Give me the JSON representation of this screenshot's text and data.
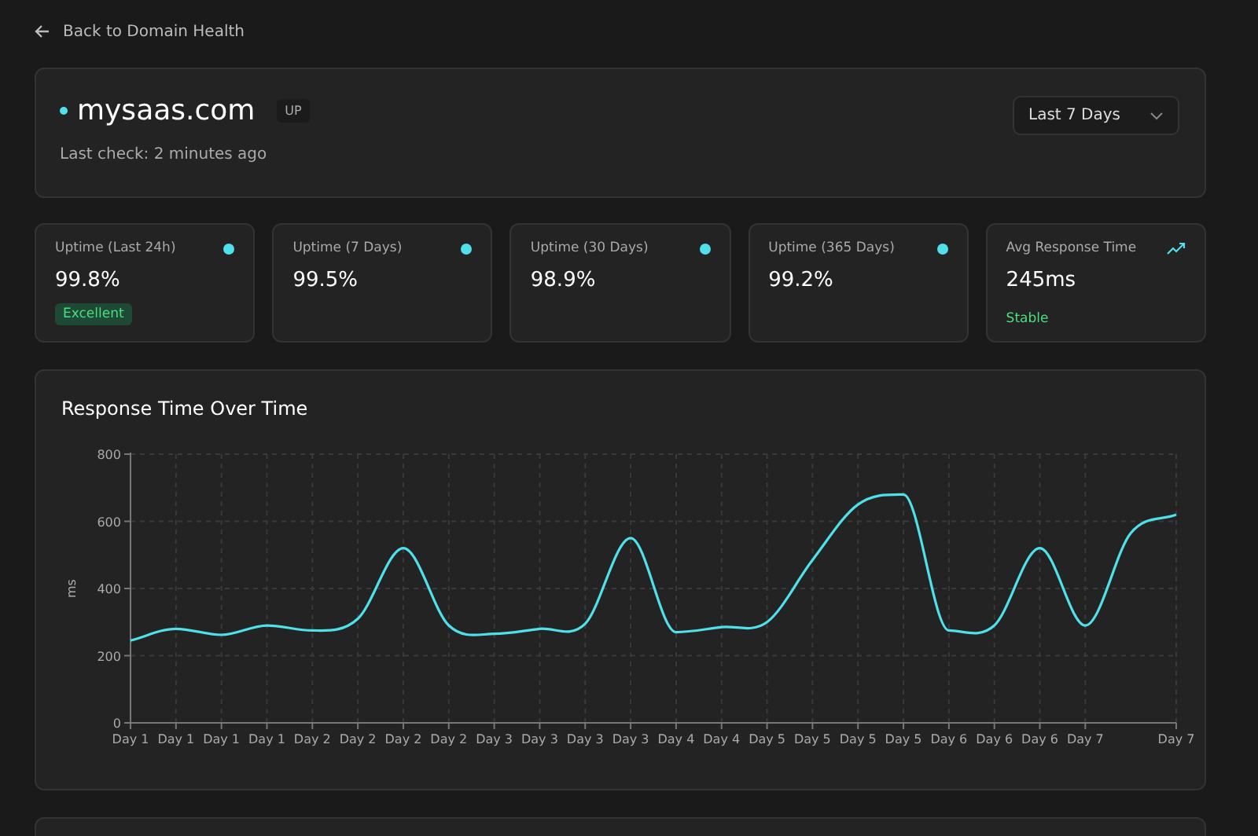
{
  "back_link": {
    "label": "Back to Domain Health"
  },
  "header": {
    "domain": "mysaas.com",
    "status_badge": "UP",
    "last_check": "Last check: 2 minutes ago",
    "period_select": {
      "value": "Last 7 Days"
    }
  },
  "stats": [
    {
      "kind": "uptime",
      "label": "Uptime (Last 24h)",
      "value": "99.8%",
      "color": "#4fe0ea",
      "badge": "Excellent"
    },
    {
      "kind": "uptime",
      "label": "Uptime (7 Days)",
      "value": "99.5%",
      "color": "#4fe0ea"
    },
    {
      "kind": "uptime",
      "label": "Uptime (30 Days)",
      "value": "98.9%",
      "color": "#4fe0ea"
    },
    {
      "kind": "uptime",
      "label": "Uptime (365 Days)",
      "value": "99.2%",
      "color": "#4fe0ea"
    },
    {
      "kind": "trend",
      "label": "Avg Response Time",
      "value": "245ms",
      "note": "Stable"
    }
  ],
  "response_chart": {
    "title": "Response Time Over Time",
    "chart_data": {
      "type": "line",
      "ylabel": "ms",
      "categories": [
        "Day 1",
        "Day 1",
        "Day 1",
        "Day 1",
        "Day 2",
        "Day 2",
        "Day 2",
        "Day 2",
        "Day 3",
        "Day 3",
        "Day 3",
        "Day 3",
        "Day 4",
        "Day 4",
        "Day 5",
        "Day 5",
        "Day 5",
        "Day 5",
        "Day 6",
        "Day 6",
        "Day 6",
        "Day 7",
        null,
        "Day 7"
      ],
      "ylim": [
        0,
        800
      ],
      "yticks": [
        0,
        200,
        400,
        600,
        800
      ],
      "grid": true,
      "series": [
        {
          "color": "#4fe0ea",
          "values": [
            245,
            280,
            262,
            290,
            275,
            310,
            520,
            290,
            265,
            280,
            295,
            550,
            270,
            285,
            300,
            485,
            650,
            680,
            275,
            290,
            520,
            290,
            565,
            620
          ]
        }
      ]
    }
  }
}
